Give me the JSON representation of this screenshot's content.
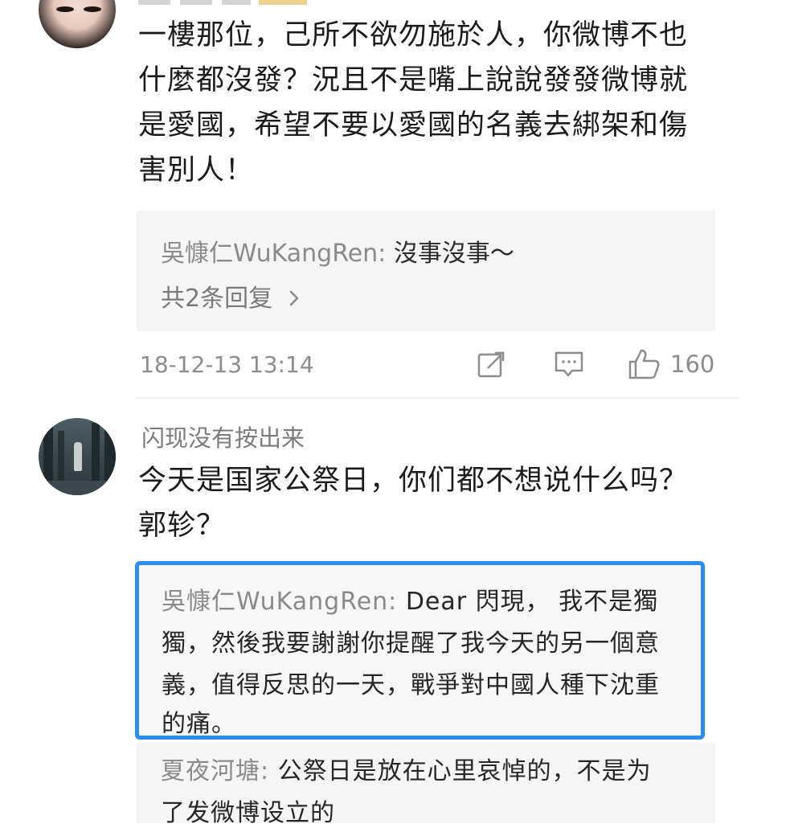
{
  "comment1": {
    "text_lines": [
      "一樓那位，己所不欲勿施於人，你微博不也",
      "什麼都沒發？況且不是嘴上說說發發微博就",
      "是愛國，希望不要以愛國的名義去綁架和傷",
      "害別人！"
    ],
    "reply": {
      "author": "吳慷仁WuKangRen:",
      "text": "沒事沒事～",
      "more_replies": "共2条回复",
      "more_icon": "chevron-right-icon"
    },
    "timestamp": "18-12-13 13:14",
    "actions": {
      "repost_icon": "repost-icon",
      "comment_icon": "comment-icon",
      "like_icon": "thumbs-up-icon",
      "like_count": "160"
    }
  },
  "comment2": {
    "username": "闪现没有按出来",
    "text_lines": [
      "今天是国家公祭日，你们都不想说什么吗？",
      "郭轸？"
    ],
    "highlighted_reply": {
      "author": "吳慷仁WuKangRen:",
      "lines": [
        "Dear 閃現， 我不是獨",
        "獨，然後我要謝謝你提醒了我今天的另一個意",
        "義，值得反思的一天，戰爭對中國人種下沈重",
        "的痛。"
      ],
      "highlight_color": "#2c8cf4"
    },
    "sub_reply": {
      "author": "夏夜河塘:",
      "lines": [
        "公祭日是放在心里哀悼的，不是为",
        "了发微博设立的"
      ]
    }
  },
  "colors": {
    "text_primary": "#1b1b1b",
    "text_secondary": "#8c8c8c",
    "reply_bg": "#f5f5f5"
  }
}
